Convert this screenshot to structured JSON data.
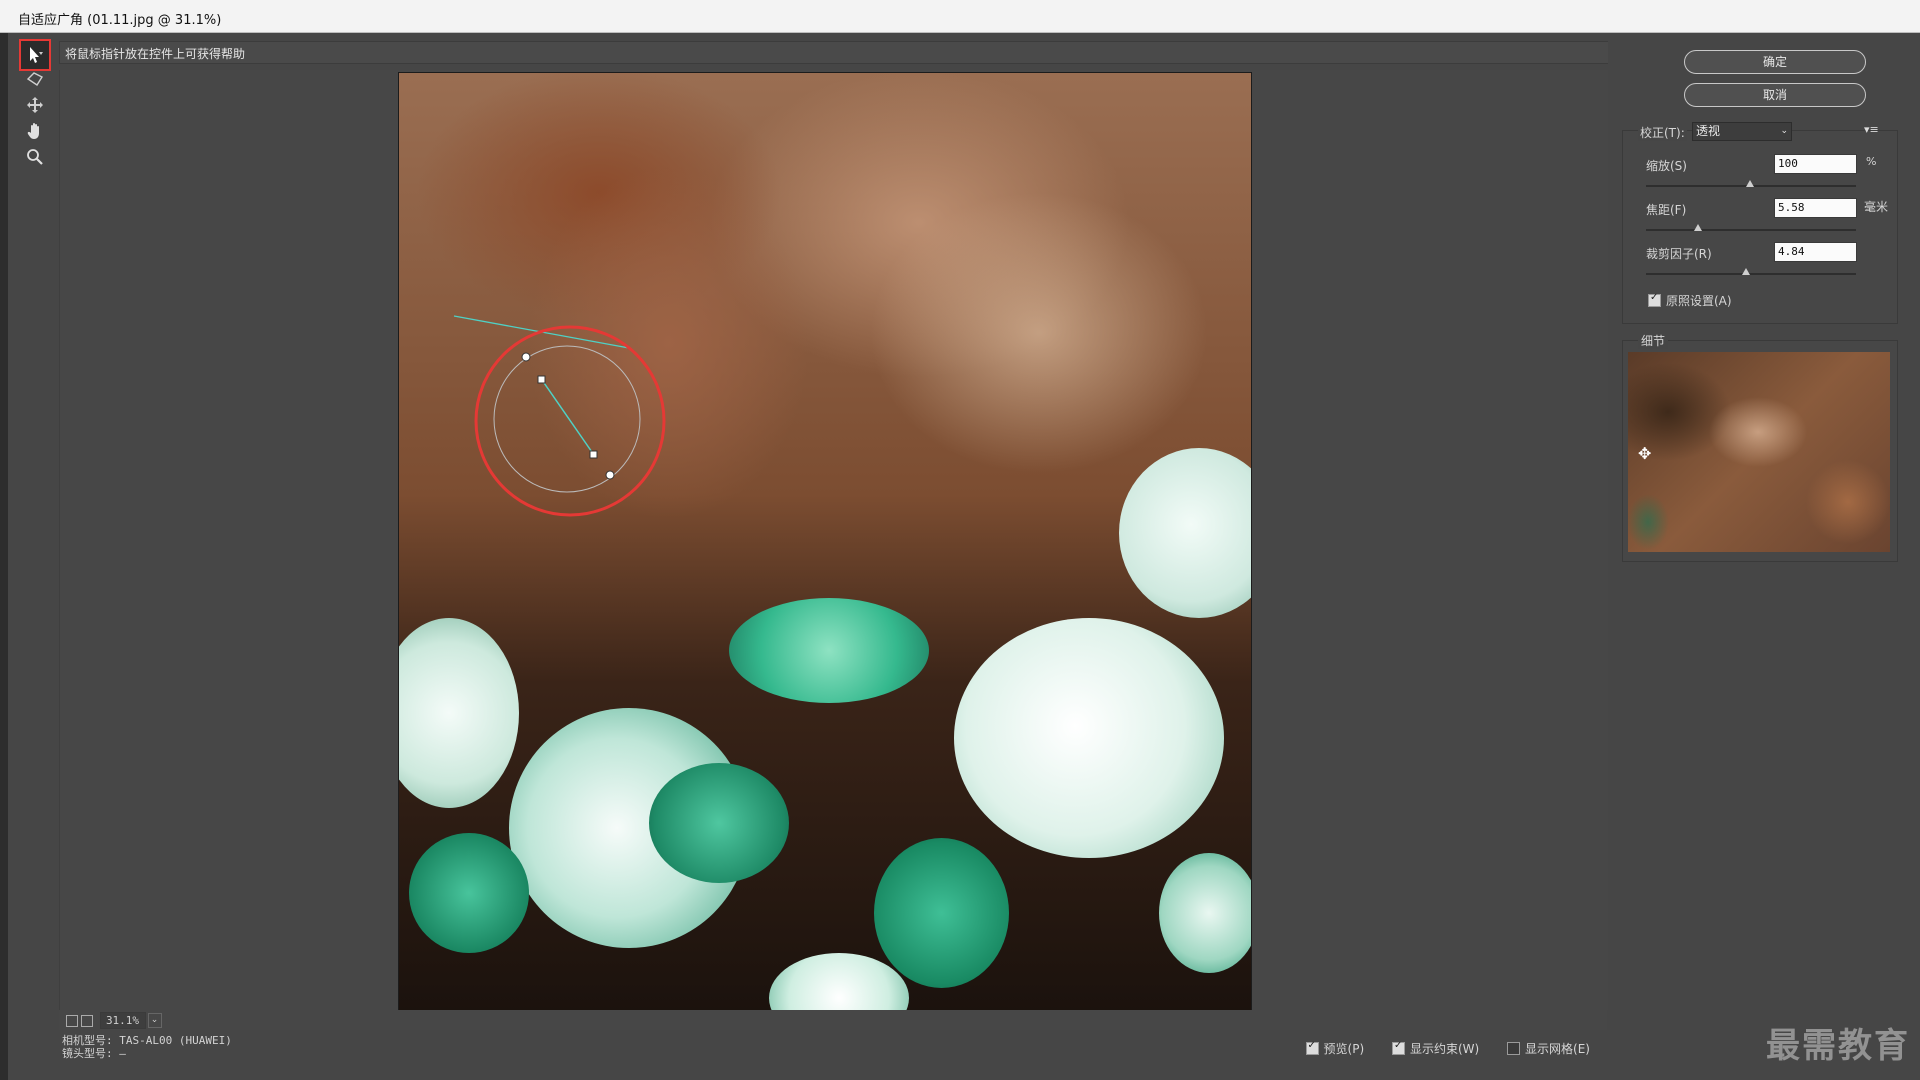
{
  "window": {
    "title": "自适应广角 (01.11.jpg @ 31.1%)"
  },
  "hint": "将鼠标指针放在控件上可获得帮助",
  "tools": [
    {
      "name": "constraint-tool",
      "icon": "arrow-constraint-icon",
      "active": true
    },
    {
      "name": "polygon-constraint-tool",
      "icon": "polygon-icon",
      "active": false
    },
    {
      "name": "move-tool",
      "icon": "move-icon",
      "active": false
    },
    {
      "name": "hand-tool",
      "icon": "hand-icon",
      "active": false
    },
    {
      "name": "zoom-tool",
      "icon": "zoom-icon",
      "active": false
    }
  ],
  "buttons": {
    "ok": "确定",
    "cancel": "取消"
  },
  "correction": {
    "label": "校正(T):",
    "value": "透视",
    "menu_icon": "panel-menu-icon"
  },
  "fields": {
    "scale": {
      "label": "缩放(S)",
      "value": "100",
      "unit": "%",
      "slider_fraction": 0.5
    },
    "focal": {
      "label": "焦距(F)",
      "value": "5.58",
      "unit": "毫米",
      "slider_fraction": 0.25
    },
    "crop": {
      "label": "裁剪因子(R)",
      "value": "4.84",
      "unit": "",
      "slider_fraction": 0.48
    },
    "as_shot": {
      "label": "原照设置(A)",
      "checked": true
    }
  },
  "detail": {
    "label": "细节"
  },
  "status": {
    "zoom": "31.1%",
    "camera_label": "相机型号:",
    "camera_value": "TAS-AL00 (HUAWEI)",
    "lens_label": "镜头型号:",
    "lens_value": "—"
  },
  "checks": {
    "preview": {
      "label": "预览(P)",
      "checked": true
    },
    "show_constraints": {
      "label": "显示约束(W)",
      "checked": true
    },
    "show_grid": {
      "label": "显示网格(E)",
      "checked": false
    }
  },
  "watermark": "最需教育",
  "colors": {
    "highlight": "#e53935",
    "constraint_line": "#4fd1c5",
    "panel_bg": "#464646"
  }
}
